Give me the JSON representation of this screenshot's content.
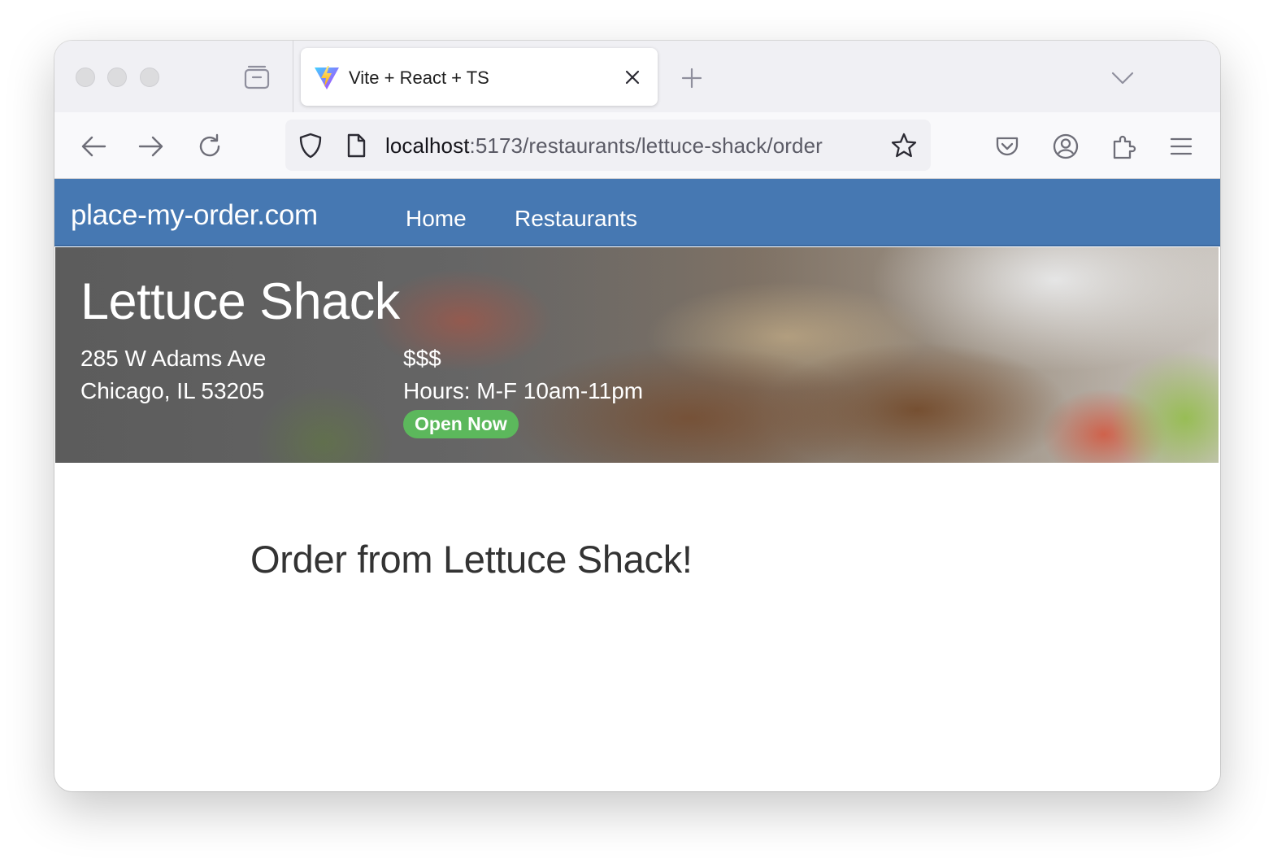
{
  "browser": {
    "tab": {
      "title": "Vite + React + TS",
      "favicon": "vite-logo"
    },
    "url": {
      "host": "localhost",
      "path": ":5173/restaurants/lettuce-shack/order"
    },
    "icons": {
      "tab_overview": "tab-overview-icon",
      "close_tab": "close-icon",
      "new_tab": "plus-icon",
      "list_tabs": "chevron-down-icon",
      "back": "arrow-left-icon",
      "forward": "arrow-right-icon",
      "reload": "reload-icon",
      "tracking_protection": "shield-icon",
      "page_info": "page-icon",
      "bookmark": "star-icon",
      "pocket": "pocket-icon",
      "account": "account-icon",
      "extensions": "puzzle-icon",
      "menu": "hamburger-menu-icon"
    }
  },
  "site": {
    "brand": "place-my-order.com",
    "nav": [
      {
        "label": "Home"
      },
      {
        "label": "Restaurants"
      }
    ],
    "header_color": "#4678b2"
  },
  "restaurant": {
    "name": "Lettuce Shack",
    "address_line1": "285 W Adams Ave",
    "address_line2": "Chicago, IL 53205",
    "price": "$$$",
    "hours": "Hours: M-F 10am-11pm",
    "status": "Open Now",
    "status_color": "#5cb85c"
  },
  "order": {
    "heading": "Order from Lettuce Shack!"
  }
}
